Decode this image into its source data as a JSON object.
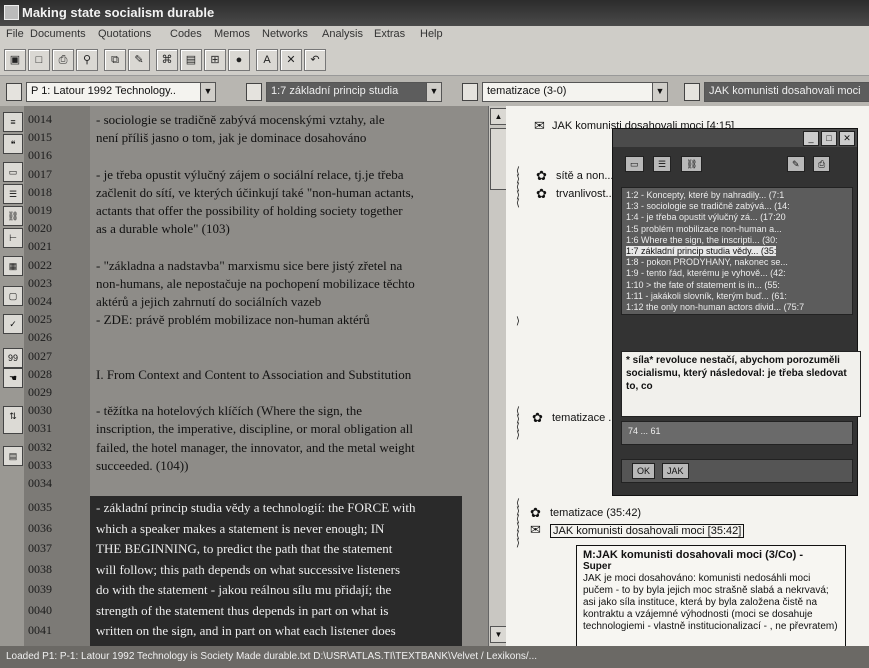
{
  "window": {
    "title": "Making state socialism durable"
  },
  "menu": [
    "File",
    "Documents",
    "Quotations",
    "Codes",
    "Memos",
    "Networks",
    "Analysis",
    "Extras",
    "Help"
  ],
  "toolbar_buttons": [
    "save-icon",
    "new-icon",
    "print-icon",
    "search-icon",
    "copy-icon",
    "edit-icon",
    "code-icon",
    "memo-icon",
    "network-icon",
    "info-icon",
    "text-icon",
    "cut-icon",
    "undo-icon"
  ],
  "selectors": {
    "document": "P 1: Latour 1992 Technology..",
    "quotation": "1:7 základní princip studia",
    "code": "tematizace (3-0)",
    "memo": "JAK komunisti dosahovali moci"
  },
  "text_lines": [
    {
      "n": "0014",
      "t": "- sociologie se tradičně zabývá mocenskými vztahy, ale"
    },
    {
      "n": "0015",
      "t": "  není příliš jasno o tom, jak je dominace dosahováno"
    },
    {
      "n": "0016",
      "t": ""
    },
    {
      "n": "0017",
      "t": "- je třeba opustit výlučný zájem o sociální relace, tj.je třeba"
    },
    {
      "n": "0018",
      "t": "začlenit do sítí, ve kterých účinkují také \"non-human actants,"
    },
    {
      "n": "0019",
      "t": "actants that offer the possibility of holding society together"
    },
    {
      "n": "0020",
      "t": "as a durable whole\" (103)"
    },
    {
      "n": "0021",
      "t": ""
    },
    {
      "n": "0022",
      "t": "- \"základna a nadstavba\" marxismu sice bere jistý zřetel na"
    },
    {
      "n": "0023",
      "t": "non-humans, ale nepostačuje na pochopení mobilizace těchto"
    },
    {
      "n": "0024",
      "t": "aktérů a jejich zahrnutí do sociálních vazeb"
    },
    {
      "n": "0025",
      "t": "- ZDE: právě problém mobilizace non-human aktérů"
    },
    {
      "n": "0026",
      "t": ""
    },
    {
      "n": "0027",
      "t": ""
    },
    {
      "n": "0028",
      "t": "I. From Context and Content to Association and Substitution"
    },
    {
      "n": "0029",
      "t": ""
    },
    {
      "n": "0030",
      "t": "- těžítka na hotelových klíčích (Where the sign, the"
    },
    {
      "n": "0031",
      "t": "inscription, the imperative, discipline, or moral obligation all"
    },
    {
      "n": "0032",
      "t": "failed, the hotel manager, the innovator, and the metal weight"
    },
    {
      "n": "0033",
      "t": "succeeded. (104))"
    },
    {
      "n": "0034",
      "t": ""
    }
  ],
  "highlight_lines": [
    {
      "n": "0035",
      "t": "- základní princip studia vědy a technologií: the FORCE with"
    },
    {
      "n": "0036",
      "t": "which a speaker makes a statement is never enough; IN"
    },
    {
      "n": "0037",
      "t": "THE BEGINNING, to predict the path that the statement"
    },
    {
      "n": "0038",
      "t": "will follow; this path depends on what successive listeners"
    },
    {
      "n": "0039",
      "t": "do with the statement - jakou reálnou sílu mu přidají; the"
    },
    {
      "n": "0040",
      "t": "strength of the statement thus depends in part on what is"
    },
    {
      "n": "0041",
      "t": "written on the sign, and in part on what each listener does"
    }
  ],
  "margin_codes": [
    {
      "label": "JAK komunisti dosahovali moci [4:15]",
      "glyph": "memo"
    },
    {
      "label": "sítě a non...",
      "glyph": "code"
    },
    {
      "label": "trvanlivost...",
      "glyph": "code"
    },
    {
      "label": "tematizace ...",
      "glyph": "code"
    },
    {
      "label": "tematizace (35:42)",
      "glyph": "code"
    },
    {
      "label": "JAK komunisti dosahovali moci [35:42]",
      "glyph": "memo"
    }
  ],
  "network_window": {
    "list_items": [
      "1:2 - Koncepty, které by nahradily... (7:1",
      "1:3 - sociologie se tradičně zabývá... (14:",
      "1:4 - je třeba opustit výlučný zá... (17:20",
      "1:5 problém mobilizace non-human a...",
      "1:6 Where the sign, the inscripti... (30:",
      "1:7 základní princip studia vědy... (35:",
      "1:8 - pokon PRODYHANY, nakonec se...",
      "1:9 - tento řád, kterému je vyhově... (42:",
      "1:10 > the fate of statement is in... (55:",
      "1:11 - jakákoli slovník, kterým buď... (61:",
      "1:12 the only non-human actors divid... (75:7"
    ],
    "selected_index": 5,
    "text": "* síla* revoluce nestačí, abychom porozuměli socialismu, který následoval: je třeba sledovat to, co",
    "bottom_label": "74 ... 61",
    "footer_buttons": [
      "OK",
      "JAK"
    ]
  },
  "tooltip": {
    "title": "M:JAK komunisti dosahovali moci (3/Co) -",
    "subtitle": "Super",
    "body": "JAK je moci dosahováno: komunisti nedosáhli moci pučem - to by byla jejich moc strašně slabá a nekrvavá; asi jako síla instituce, která by byla založena čistě na kontraktu a vzájemné výhodnosti (moci se dosahuje technologiemi - vlastně institucionalizací - , ne převratem)"
  },
  "status": "Loaded P1: P-1: Latour 1992 Technology is Society Made durable.txt  D:\\USR\\ATLAS.TI\\TEXTBANK\\Velvet / Lexikons/..."
}
